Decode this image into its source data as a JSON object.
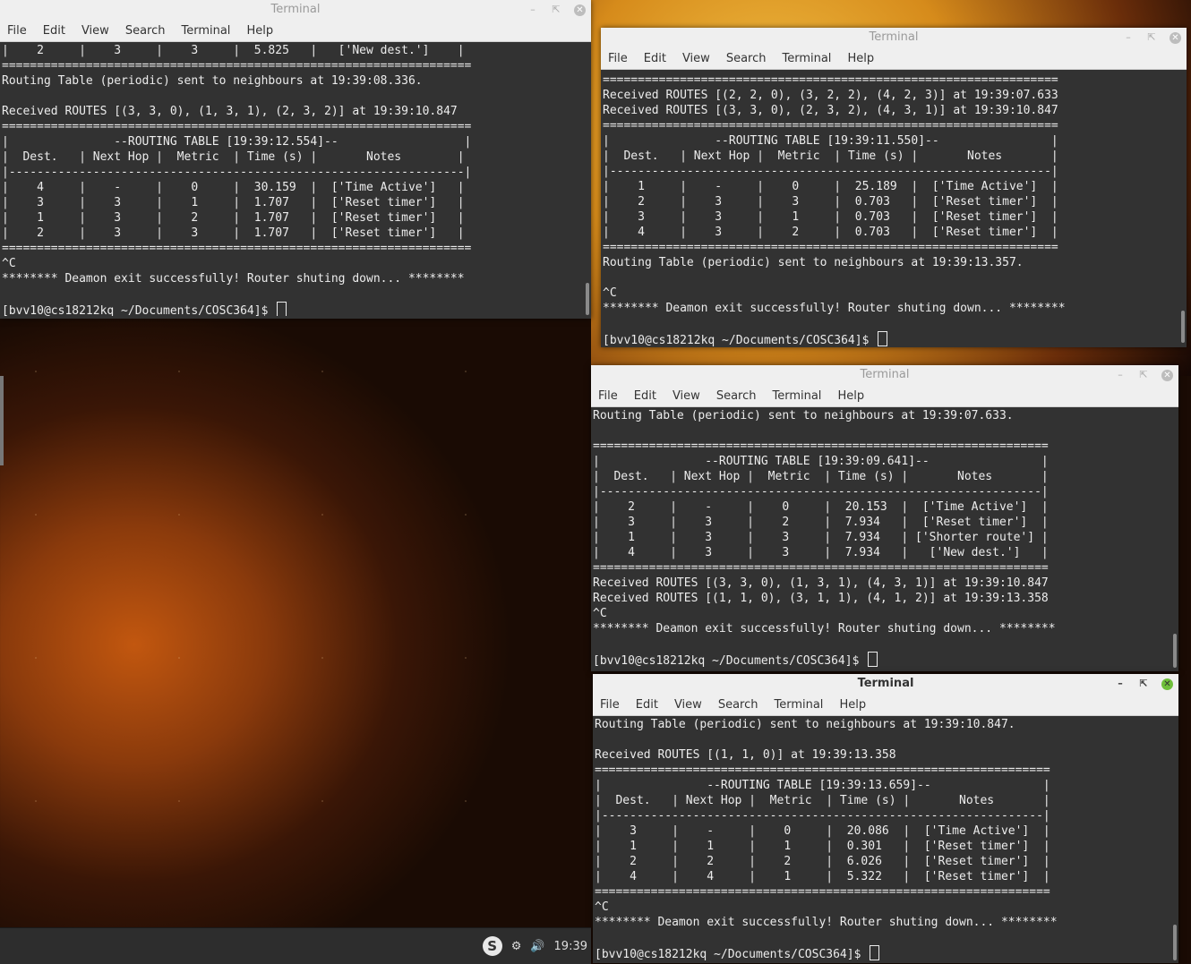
{
  "menu": [
    "File",
    "Edit",
    "View",
    "Search",
    "Terminal",
    "Help"
  ],
  "windows": [
    {
      "title": "Terminal",
      "lines": [
        "|    2     |    3     |    3     |  5.825   |   ['New dest.']    |",
        "===================================================================",
        "Routing Table (periodic) sent to neighbours at 19:39:08.336.",
        "",
        "Received ROUTES [(3, 3, 0), (1, 3, 1), (2, 3, 2)] at 19:39:10.847",
        "===================================================================",
        "|               --ROUTING TABLE [19:39:12.554]--                  |",
        "|  Dest.   | Next Hop |  Metric  | Time (s) |       Notes        |",
        "|-----------------------------------------------------------------|",
        "|    4     |    -     |    0     |  30.159  |  ['Time Active']   |",
        "|    3     |    3     |    1     |  1.707   |  ['Reset timer']   |",
        "|    1     |    3     |    2     |  1.707   |  ['Reset timer']   |",
        "|    2     |    3     |    3     |  1.707   |  ['Reset timer']   |",
        "===================================================================",
        "^C",
        "******** Deamon exit successfully! Router shuting down... ********",
        "",
        "[bvv10@cs18212kq ~/Documents/COSC364]$ "
      ]
    },
    {
      "title": "Terminal",
      "lines": [
        "=================================================================",
        "Received ROUTES [(2, 2, 0), (3, 2, 2), (4, 2, 3)] at 19:39:07.633",
        "Received ROUTES [(3, 3, 0), (2, 3, 2), (4, 3, 1)] at 19:39:10.847",
        "=================================================================",
        "|               --ROUTING TABLE [19:39:11.550]--                |",
        "|  Dest.   | Next Hop |  Metric  | Time (s) |       Notes       |",
        "|---------------------------------------------------------------|",
        "|    1     |    -     |    0     |  25.189  |  ['Time Active']  |",
        "|    2     |    3     |    3     |  0.703   |  ['Reset timer']  |",
        "|    3     |    3     |    1     |  0.703   |  ['Reset timer']  |",
        "|    4     |    3     |    2     |  0.703   |  ['Reset timer']  |",
        "=================================================================",
        "Routing Table (periodic) sent to neighbours at 19:39:13.357.",
        "",
        "^C",
        "******** Deamon exit successfully! Router shuting down... ********",
        "",
        "[bvv10@cs18212kq ~/Documents/COSC364]$ "
      ]
    },
    {
      "title": "Terminal",
      "lines": [
        "Routing Table (periodic) sent to neighbours at 19:39:07.633.",
        "",
        "=================================================================",
        "|               --ROUTING TABLE [19:39:09.641]--                |",
        "|  Dest.   | Next Hop |  Metric  | Time (s) |       Notes       |",
        "|---------------------------------------------------------------|",
        "|    2     |    -     |    0     |  20.153  |  ['Time Active']  |",
        "|    3     |    3     |    2     |  7.934   |  ['Reset timer']  |",
        "|    1     |    3     |    3     |  7.934   | ['Shorter route'] |",
        "|    4     |    3     |    3     |  7.934   |   ['New dest.']   |",
        "=================================================================",
        "Received ROUTES [(3, 3, 0), (1, 3, 1), (4, 3, 1)] at 19:39:10.847",
        "Received ROUTES [(1, 1, 0), (3, 1, 1), (4, 1, 2)] at 19:39:13.358",
        "^C",
        "******** Deamon exit successfully! Router shuting down... ********",
        "",
        "[bvv10@cs18212kq ~/Documents/COSC364]$ "
      ]
    },
    {
      "title": "Terminal",
      "lines": [
        "Routing Table (periodic) sent to neighbours at 19:39:10.847.",
        "",
        "Received ROUTES [(1, 1, 0)] at 19:39:13.358",
        "=================================================================",
        "|               --ROUTING TABLE [19:39:13.659]--                |",
        "|  Dest.   | Next Hop |  Metric  | Time (s) |       Notes       |",
        "|---------------------------------------------------------------|",
        "|    3     |    -     |    0     |  20.086  |  ['Time Active']  |",
        "|    1     |    1     |    1     |  0.301   |  ['Reset timer']  |",
        "|    2     |    2     |    2     |  6.026   |  ['Reset timer']  |",
        "|    4     |    4     |    1     |  5.322   |  ['Reset timer']  |",
        "=================================================================",
        "^C",
        "******** Deamon exit successfully! Router shuting down... ********",
        "",
        "[bvv10@cs18212kq ~/Documents/COSC364]$ "
      ]
    }
  ],
  "taskbar": {
    "clock": "19:39",
    "skype_label": "S"
  }
}
